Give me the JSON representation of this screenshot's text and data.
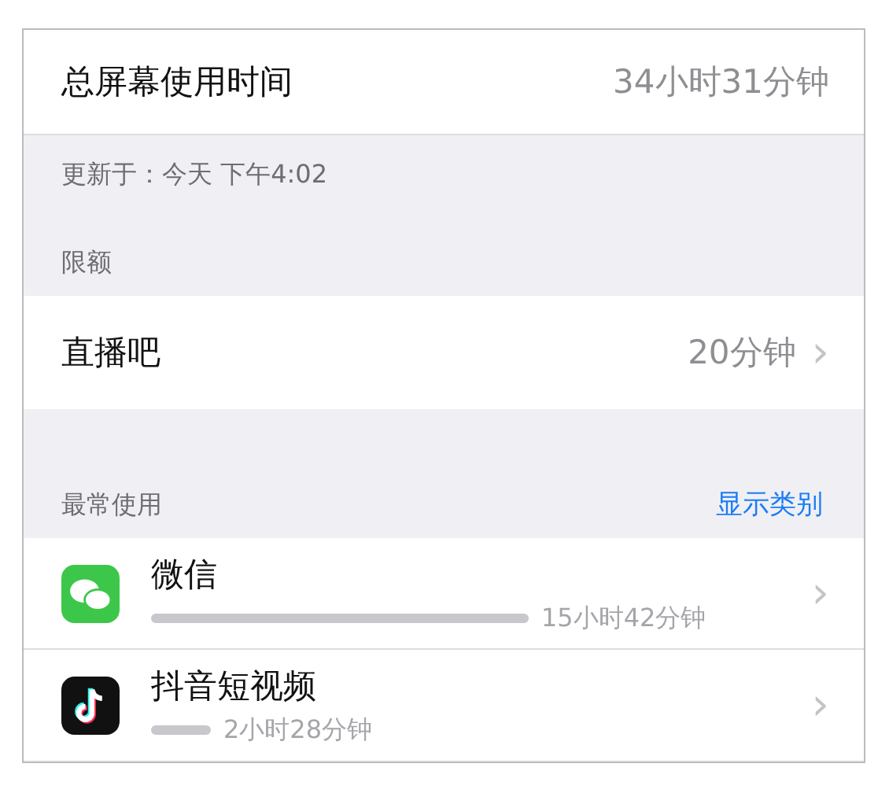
{
  "total": {
    "label": "总屏幕使用时间",
    "value": "34小时31分钟"
  },
  "updated": "更新于：今天 下午4:02",
  "limits": {
    "header": "限额",
    "items": [
      {
        "name": "直播吧",
        "value": "20分钟",
        "chevron": "›"
      }
    ]
  },
  "most_used": {
    "header": "最常使用",
    "action": "显示类别",
    "apps": [
      {
        "name": "微信",
        "kind": "chat",
        "time": "15小时42分钟",
        "chevron": "›"
      },
      {
        "name": "抖音短视频",
        "kind": "note",
        "time": "2小时28分钟",
        "chevron": "›"
      }
    ]
  }
}
